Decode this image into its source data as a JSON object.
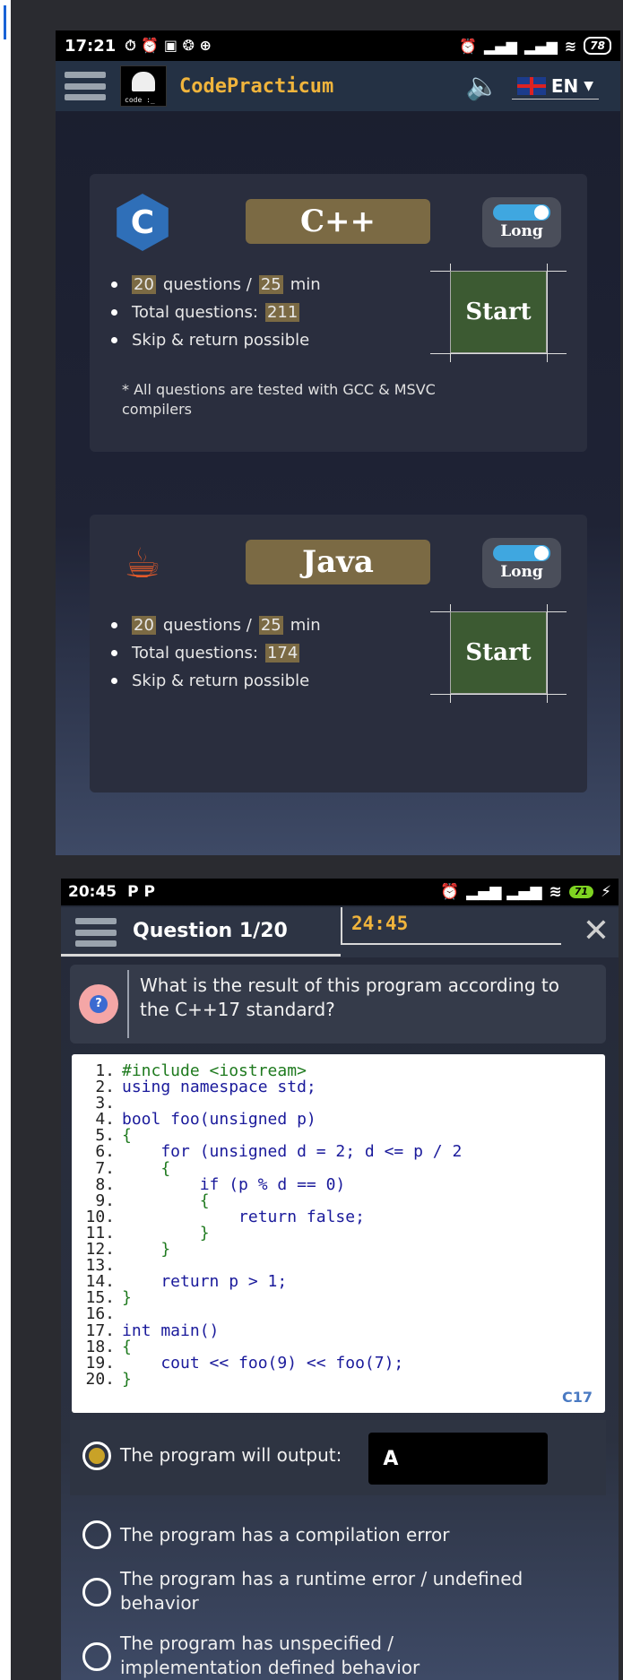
{
  "phone1": {
    "status": {
      "time": "17:21",
      "battery": "78"
    },
    "appbar": {
      "brand": "CodePracticum",
      "logo_text": "code :_",
      "language": "EN"
    },
    "courses": [
      {
        "name": "C++",
        "icon": "cpp-logo-icon",
        "toggle_label": "Long",
        "questions": "20",
        "questions_suffix": "questions /",
        "minutes": "25",
        "minutes_suffix": "min",
        "total_prefix": "Total questions:",
        "total": "211",
        "skip": "Skip & return possible",
        "note": "* All questions are tested with GCC & MSVC compilers",
        "start_label": "Start"
      },
      {
        "name": "Java",
        "icon": "java-logo-icon",
        "toggle_label": "Long",
        "questions": "20",
        "questions_suffix": "questions /",
        "minutes": "25",
        "minutes_suffix": "min",
        "total_prefix": "Total questions:",
        "total": "174",
        "skip": "Skip & return possible",
        "start_label": "Start"
      }
    ]
  },
  "phone2": {
    "status": {
      "time": "20:45",
      "battery": "71"
    },
    "header": {
      "question": "Question 1/20",
      "timer": "24:45"
    },
    "question_text": "What is the result of this program according to the C++17 standard?",
    "code_badge": "17",
    "code_lines": [
      {
        "n": "1.",
        "t": "#include <iostream>"
      },
      {
        "n": "2.",
        "t": "using namespace std;"
      },
      {
        "n": "3.",
        "t": ""
      },
      {
        "n": "4.",
        "t": "bool foo(unsigned p)"
      },
      {
        "n": "5.",
        "t": "{"
      },
      {
        "n": "6.",
        "t": "    for (unsigned d = 2; d <= p / 2"
      },
      {
        "n": "7.",
        "t": "    {"
      },
      {
        "n": "8.",
        "t": "        if (p % d == 0)"
      },
      {
        "n": "9.",
        "t": "        {"
      },
      {
        "n": "10.",
        "t": "            return false;"
      },
      {
        "n": "11.",
        "t": "        }"
      },
      {
        "n": "12.",
        "t": "    }"
      },
      {
        "n": "13.",
        "t": ""
      },
      {
        "n": "14.",
        "t": "    return p > 1;"
      },
      {
        "n": "15.",
        "t": "}"
      },
      {
        "n": "16.",
        "t": ""
      },
      {
        "n": "17.",
        "t": "int main()"
      },
      {
        "n": "18.",
        "t": "{"
      },
      {
        "n": "19.",
        "t": "    cout << foo(9) << foo(7);"
      },
      {
        "n": "20.",
        "t": "}"
      }
    ],
    "answers": {
      "output_label": "The program will output:",
      "output_value": "A",
      "compile_error": "The program has a compilation error",
      "runtime_error": "The program has a runtime error / undefined behavior",
      "unspecified": "The program has unspecified / implementation defined behavior"
    }
  }
}
